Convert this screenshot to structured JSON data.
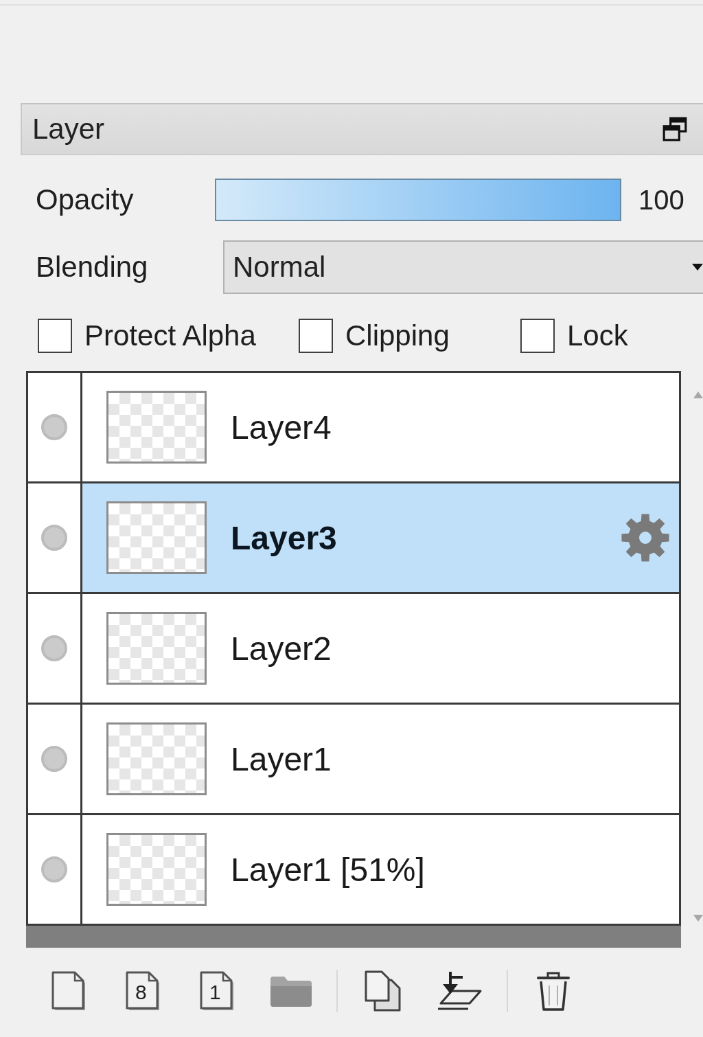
{
  "panel": {
    "title": "Layer"
  },
  "opacity": {
    "label": "Opacity",
    "level": 1,
    "reading": "100"
  },
  "blending": {
    "label": "Blending",
    "value": "Normal"
  },
  "options": [
    {
      "label": "Protect Alpha",
      "checked": false
    },
    {
      "label": "Clipping",
      "checked": false
    },
    {
      "label": "Lock",
      "checked": false
    }
  ],
  "layers": [
    {
      "name": "Layer4",
      "selected": false
    },
    {
      "name": "Layer3",
      "selected": true
    },
    {
      "name": "Layer2",
      "selected": false
    },
    {
      "name": "Layer1",
      "selected": false
    },
    {
      "name": "Layer1 [51%]",
      "selected": false
    }
  ],
  "toolbar": [
    [
      {
        "kind": "page"
      },
      {
        "kind": "page",
        "label": "8"
      },
      {
        "kind": "page",
        "label": "1"
      },
      {
        "kind": "folder"
      }
    ],
    [
      {
        "kind": "copy"
      },
      {
        "kind": "merge"
      }
    ],
    [
      {
        "kind": "trash"
      }
    ]
  ]
}
